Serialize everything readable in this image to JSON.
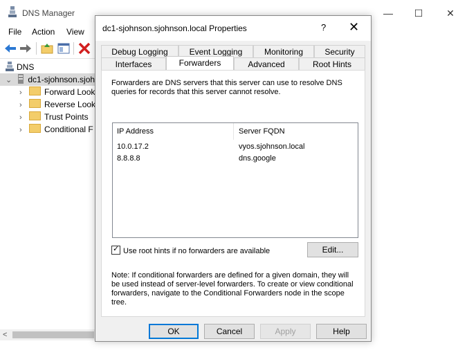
{
  "main_window": {
    "title": "DNS Manager",
    "controls": {
      "minimize": "—",
      "maximize": "☐",
      "close": "✕"
    }
  },
  "menu": [
    "File",
    "Action",
    "View"
  ],
  "toolbar": {
    "buttons": [
      "back-arrow-icon",
      "forward-arrow-icon",
      "folder-up-icon",
      "properties-icon",
      "delete-icon"
    ]
  },
  "tree": {
    "root": "DNS",
    "server": "dc1-sjohnson.sjoh",
    "children": [
      "Forward Looku",
      "Reverse Looku",
      "Trust Points",
      "Conditional F"
    ]
  },
  "scroll": {
    "left_arrow": "<"
  },
  "dialog": {
    "title": "dc1-sjohnson.sjohnson.local Properties",
    "help": "?",
    "close": "✕",
    "tabs_row1": [
      "Debug Logging",
      "Event Logging",
      "Monitoring",
      "Security"
    ],
    "tabs_row2": [
      "Interfaces",
      "Forwarders",
      "Advanced",
      "Root Hints"
    ],
    "active_tab": "Forwarders",
    "description": "Forwarders are DNS servers that this server can use to resolve DNS queries for records that this server cannot resolve.",
    "list": {
      "columns": [
        "IP Address",
        "Server FQDN"
      ],
      "rows": [
        {
          "ip": "10.0.17.2",
          "fqdn": "vyos.sjohnson.local"
        },
        {
          "ip": "8.8.8.8",
          "fqdn": "dns.google"
        }
      ]
    },
    "use_root_hints": {
      "label": "Use root hints if no forwarders are available",
      "checked": true,
      "mark": "✓"
    },
    "edit_button": "Edit...",
    "note": "Note: If conditional forwarders are defined for a given domain, they will be used instead of server-level forwarders.  To create or view conditional forwarders, navigate to the Conditional Forwarders node in the scope tree.",
    "buttons": {
      "ok": "OK",
      "cancel": "Cancel",
      "apply": "Apply",
      "help": "Help"
    }
  }
}
